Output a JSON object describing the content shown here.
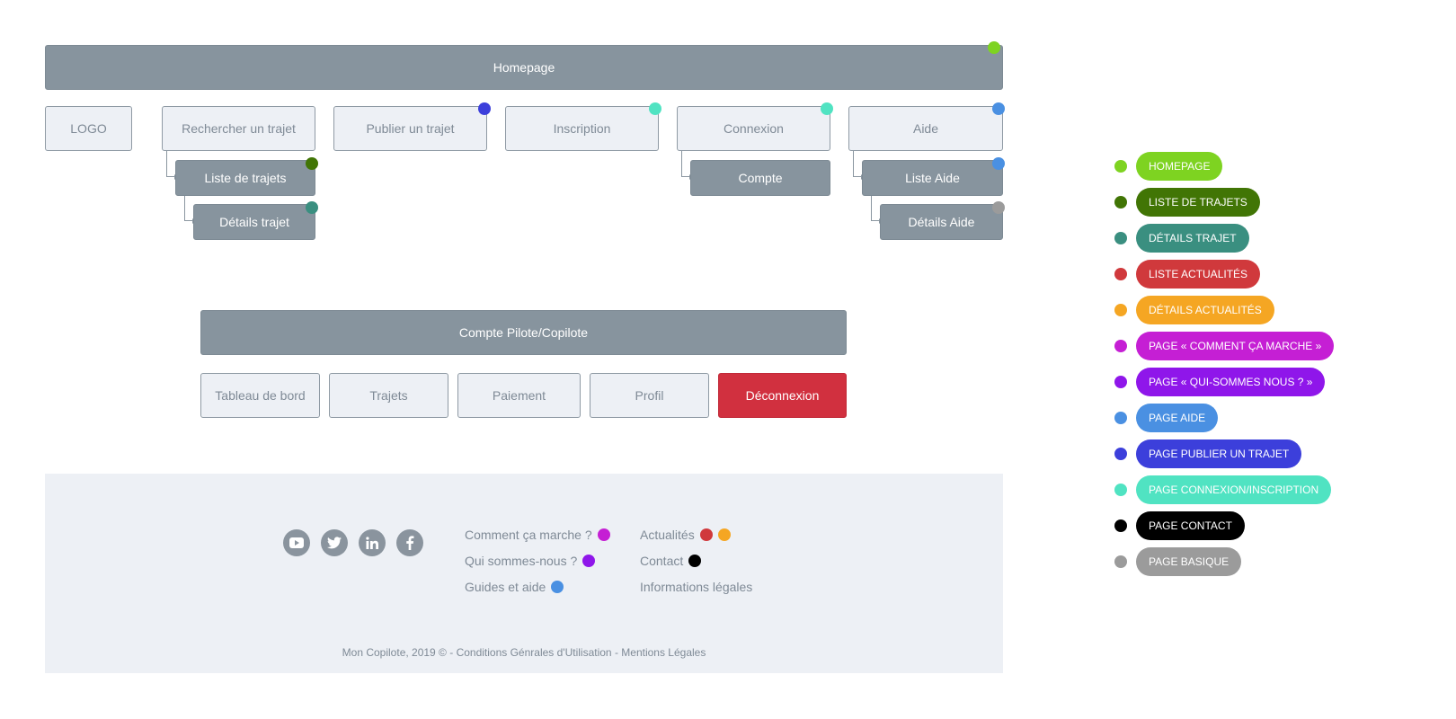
{
  "sitemap": {
    "homepage": "Homepage",
    "logo": "LOGO",
    "rechercher": "Rechercher un trajet",
    "publier": "Publier un trajet",
    "inscription": "Inscription",
    "connexion": "Connexion",
    "aide": "Aide",
    "liste_trajets": "Liste de trajets",
    "details_trajet": "Détails trajet",
    "compte": "Compte",
    "liste_aide": "Liste Aide",
    "details_aide": "Détails Aide"
  },
  "account": {
    "title": "Compte Pilote/Copilote",
    "tableau": "Tableau de bord",
    "trajets": "Trajets",
    "paiement": "Paiement",
    "profil": "Profil",
    "deconnexion": "Déconnexion"
  },
  "footer": {
    "social_icons": [
      "youtube-icon",
      "twitter-icon",
      "linkedin-icon",
      "facebook-icon"
    ],
    "comment": "Comment ça marche ?",
    "qui": "Qui sommes-nous ?",
    "guides": "Guides et aide",
    "actualites": "Actualités",
    "contact": "Contact",
    "infos": "Informations légales",
    "copyright": "Mon Copilote, 2019 © - Conditions Génrales d'Utilisation - Mentions Légales"
  },
  "legend": [
    {
      "label": "HOMEPAGE",
      "color": "#7ed321"
    },
    {
      "label": "LISTE DE TRAJETS",
      "color": "#417505"
    },
    {
      "label": "DÉTAILS TRAJET",
      "color": "#3a8f80"
    },
    {
      "label": "LISTE ACTUALITÉS",
      "color": "#d0393c"
    },
    {
      "label": "DÉTAILS ACTUALITÉS",
      "color": "#f5a623"
    },
    {
      "label": "PAGE « COMMENT ÇA  MARCHE »",
      "color": "#c51fd4"
    },
    {
      "label": "PAGE « QUI-SOMMES NOUS ? »",
      "color": "#8f16ea"
    },
    {
      "label": "PAGE AIDE",
      "color": "#4a90e2"
    },
    {
      "label": "PAGE PUBLIER UN TRAJET",
      "color": "#3c3fdb"
    },
    {
      "label": "PAGE CONNEXION/INSCRIPTION",
      "color": "#50e3c2"
    },
    {
      "label": "PAGE CONTACT",
      "color": "#000000"
    },
    {
      "label": "PAGE BASIQUE",
      "color": "#9b9b9b"
    }
  ],
  "colors": {
    "node_dark": "#87949e",
    "node_light": "#edf0f5",
    "danger": "#d1303f"
  }
}
